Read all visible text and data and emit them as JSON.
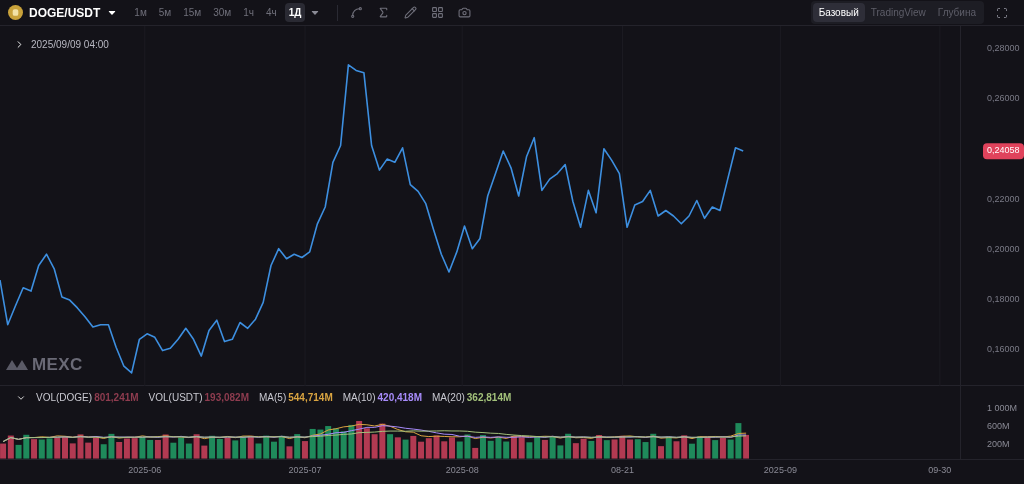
{
  "pair": {
    "symbol": "DOGE/USDT"
  },
  "intervals": [
    {
      "label": "1м",
      "selected": false
    },
    {
      "label": "5м",
      "selected": false
    },
    {
      "label": "15м",
      "selected": false
    },
    {
      "label": "30м",
      "selected": false
    },
    {
      "label": "1ч",
      "selected": false
    },
    {
      "label": "4ч",
      "selected": false
    },
    {
      "label": "1Д",
      "selected": true
    }
  ],
  "views": [
    {
      "label": "Базовый",
      "selected": true
    },
    {
      "label": "TradingView",
      "selected": false
    },
    {
      "label": "Глубина",
      "selected": false
    }
  ],
  "crosshair_date": "2025/09/09 04:00",
  "watermark": "MEXC",
  "x_axis_labels": [
    "2025-06",
    "2025-07",
    "2025-08",
    "08-21",
    "2025-09",
    "09-30"
  ],
  "price_chart": {
    "last_price": "0,24058",
    "chart_data": {
      "type": "line",
      "ylim": [
        0.1458,
        0.2892
      ],
      "yticks": [
        {
          "value": 0.28,
          "label": "0,28000"
        },
        {
          "value": 0.26,
          "label": "0,26000"
        },
        {
          "value": 0.22,
          "label": "0,22000"
        },
        {
          "value": 0.2,
          "label": "0,20000"
        },
        {
          "value": 0.18,
          "label": "0,18000"
        },
        {
          "value": 0.16,
          "label": "0,16000"
        }
      ],
      "series": [
        {
          "color": "#3d8fe0",
          "values": [
            0.188,
            0.1702,
            0.1778,
            0.1849,
            0.1836,
            0.1938,
            0.1983,
            0.1925,
            0.1813,
            0.18,
            0.1769,
            0.1733,
            0.1693,
            0.1702,
            0.1702,
            0.1612,
            0.1537,
            0.151,
            0.1644,
            0.1666,
            0.1652,
            0.1599,
            0.1608,
            0.1644,
            0.1688,
            0.1644,
            0.1577,
            0.1679,
            0.172,
            0.1635,
            0.1644,
            0.1711,
            0.1688,
            0.1724,
            0.1791,
            0.1938,
            0.2005,
            0.1965,
            0.1983,
            0.197,
            0.1992,
            0.2104,
            0.2171,
            0.2349,
            0.2416,
            0.2737,
            0.2715,
            0.2706,
            0.2416,
            0.2318,
            0.2362,
            0.2349,
            0.2407,
            0.226,
            0.2233,
            0.2184,
            0.2081,
            0.1983,
            0.1912,
            0.1992,
            0.2095,
            0.2005,
            0.2046,
            0.2215,
            0.2304,
            0.2394,
            0.2327,
            0.2215,
            0.2371,
            0.2447,
            0.2237,
            0.2282,
            0.2304,
            0.234,
            0.2193,
            0.209,
            0.2237,
            0.2148,
            0.2403,
            0.2358,
            0.2304,
            0.209,
            0.2179,
            0.2193,
            0.2237,
            0.2135,
            0.2157,
            0.2135,
            0.2104,
            0.2135,
            0.2197,
            0.2126,
            0.2171,
            0.2157,
            0.2282,
            0.2407,
            0.2394
          ]
        }
      ]
    }
  },
  "volume": {
    "legend": [
      {
        "label": "VOL(DOGE)",
        "value": "801,241M",
        "color": "#8e3c4f"
      },
      {
        "label": "VOL(USDT)",
        "value": "193,082M",
        "color": "#8e3c4f"
      },
      {
        "label": "MA(5)",
        "value": "544,714M",
        "color": "#d9a441"
      },
      {
        "label": "MA(10)",
        "value": "420,418M",
        "color": "#a78bfa"
      },
      {
        "label": "MA(20)",
        "value": "362,814M",
        "color": "#a3c17a"
      }
    ],
    "axis_labels": [
      "1 000M",
      "600M",
      "200M"
    ]
  }
}
